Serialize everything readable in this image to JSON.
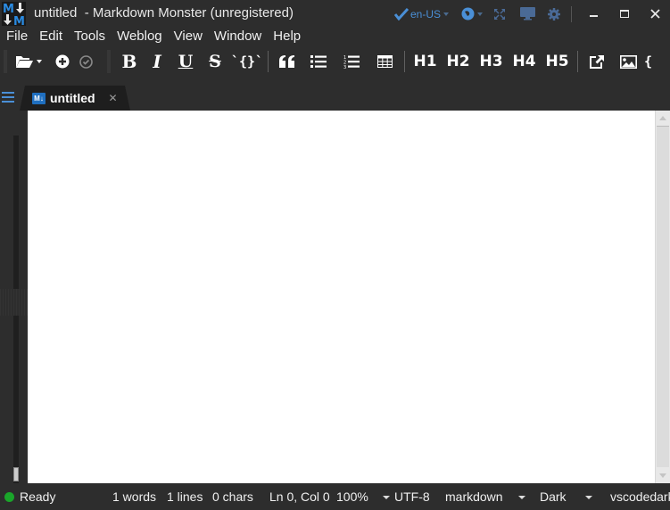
{
  "window": {
    "title": "untitled  - Markdown Monster (unregistered)",
    "spellcheck_language": "en-US",
    "title_icons": [
      "spellcheck-icon",
      "globe-icon",
      "fullscreen-icon",
      "presentation-icon",
      "settings-icon"
    ],
    "controls": [
      "minimize",
      "maximize",
      "close"
    ]
  },
  "menu": {
    "items": [
      "File",
      "Edit",
      "Tools",
      "Weblog",
      "View",
      "Window",
      "Help"
    ]
  },
  "toolbar": {
    "bold": "B",
    "italic": "I",
    "underline": "U",
    "strike": "S",
    "code": "`{}`",
    "headings": [
      "H1",
      "H2",
      "H3",
      "H4",
      "H5"
    ],
    "icons": [
      "open-folder-icon",
      "new-document-icon",
      "save-check-icon",
      "bold-icon",
      "italic-icon",
      "underline-icon",
      "strikethrough-icon",
      "inline-code-icon",
      "quote-icon",
      "bullet-list-icon",
      "numbered-list-icon",
      "table-icon",
      "link-icon",
      "image-icon",
      "code-block-icon"
    ]
  },
  "tabs": [
    {
      "label": "untitled",
      "icon_text": "M↓",
      "active": true
    }
  ],
  "editor": {
    "content": ""
  },
  "status": {
    "state": "Ready",
    "state_color": "#1aa52a",
    "words": "1 words",
    "lines": "1 lines",
    "chars": "0 chars",
    "position": "Ln 0, Col 0",
    "zoom": "100%",
    "encoding": "UTF-8",
    "mode": "markdown",
    "theme": "Dark",
    "editor_theme": "vscodedark"
  },
  "colors": {
    "accent": "#4a8fd6",
    "background": "#2d2d2d",
    "editor": "#ffffff"
  }
}
